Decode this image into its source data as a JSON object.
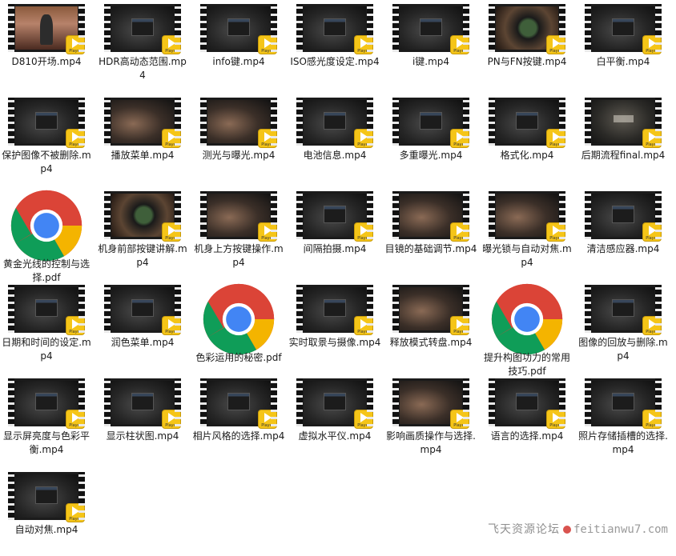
{
  "files": [
    {
      "name": "D810开场.mp4",
      "kind": "video",
      "scene": "person"
    },
    {
      "name": "HDR高动态范围.mp4",
      "kind": "video",
      "scene": "screen"
    },
    {
      "name": "info键.mp4",
      "kind": "video",
      "scene": "camera-back"
    },
    {
      "name": "ISO感光度设定.mp4",
      "kind": "video",
      "scene": "screen"
    },
    {
      "name": "i键.mp4",
      "kind": "video",
      "scene": "camera-back"
    },
    {
      "name": "PN与FN按键.mp4",
      "kind": "video",
      "scene": "lens"
    },
    {
      "name": "白平衡.mp4",
      "kind": "video",
      "scene": "screen"
    },
    {
      "name": "保护图像不被删除.mp4",
      "kind": "video",
      "scene": "camera-back"
    },
    {
      "name": "播放菜单.mp4",
      "kind": "video",
      "scene": "hand"
    },
    {
      "name": "测光与曝光.mp4",
      "kind": "video",
      "scene": "hand"
    },
    {
      "name": "电池信息.mp4",
      "kind": "video",
      "scene": "screen"
    },
    {
      "name": "多重曝光.mp4",
      "kind": "video",
      "scene": "screen"
    },
    {
      "name": "格式化.mp4",
      "kind": "video",
      "scene": "screen"
    },
    {
      "name": "后期流程final.mp4",
      "kind": "video",
      "scene": "title"
    },
    {
      "name": "黄金光线的控制与选择.pdf",
      "kind": "pdf"
    },
    {
      "name": "机身前部按键讲解.mp4",
      "kind": "video",
      "scene": "lens"
    },
    {
      "name": "机身上方按键操作.mp4",
      "kind": "video",
      "scene": "hand"
    },
    {
      "name": "间隔拍摄.mp4",
      "kind": "video",
      "scene": "screen"
    },
    {
      "name": "目镜的基础调节.mp4",
      "kind": "video",
      "scene": "hand"
    },
    {
      "name": "曝光锁与自动对焦.mp4",
      "kind": "video",
      "scene": "hand"
    },
    {
      "name": "清洁感应器.mp4",
      "kind": "video",
      "scene": "screen"
    },
    {
      "name": "日期和时间的设定.mp4",
      "kind": "video",
      "scene": "screen"
    },
    {
      "name": "润色菜单.mp4",
      "kind": "video",
      "scene": "screen"
    },
    {
      "name": "色彩运用的秘密.pdf",
      "kind": "pdf"
    },
    {
      "name": "实时取景与摄像.mp4",
      "kind": "video",
      "scene": "camera-back"
    },
    {
      "name": "释放模式转盘.mp4",
      "kind": "video",
      "scene": "hand"
    },
    {
      "name": "提升构图功力的常用技巧.pdf",
      "kind": "pdf"
    },
    {
      "name": "图像的回放与删除.mp4",
      "kind": "video",
      "scene": "camera-back"
    },
    {
      "name": "显示屏亮度与色彩平衡.mp4",
      "kind": "video",
      "scene": "screen"
    },
    {
      "name": "显示柱状图.mp4",
      "kind": "video",
      "scene": "camera-back"
    },
    {
      "name": "相片风格的选择.mp4",
      "kind": "video",
      "scene": "screen"
    },
    {
      "name": "虚拟水平仪.mp4",
      "kind": "video",
      "scene": "camera-back"
    },
    {
      "name": "影响画质操作与选择.mp4",
      "kind": "video",
      "scene": "hand"
    },
    {
      "name": "语言的选择.mp4",
      "kind": "video",
      "scene": "screen"
    },
    {
      "name": "照片存储插槽的选择.mp4",
      "kind": "video",
      "scene": "camera-back"
    },
    {
      "name": "自动对焦.mp4",
      "kind": "video",
      "scene": "screen"
    }
  ],
  "watermark": {
    "cn": "飞天资源论坛",
    "en": "feitianwu7.com"
  },
  "colors": {
    "badge": "#f5c518",
    "chrome_red": "#db4437",
    "chrome_green": "#0f9d58",
    "chrome_yellow": "#f4b400",
    "chrome_blue": "#4285f4"
  },
  "icons": {
    "video": "video-thumbnail-icon",
    "pdf": "chrome-pdf-icon",
    "badge": "player-badge-icon"
  }
}
